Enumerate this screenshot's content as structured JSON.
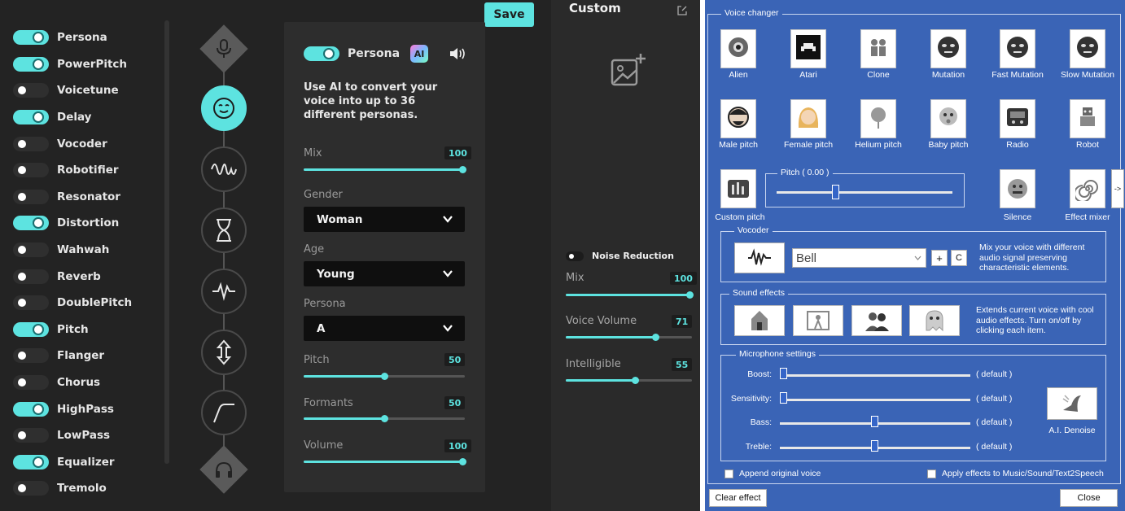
{
  "left_app": {
    "effects": [
      {
        "label": "Persona",
        "on": true
      },
      {
        "label": "PowerPitch",
        "on": true
      },
      {
        "label": "Voicetune",
        "on": false
      },
      {
        "label": "Delay",
        "on": true
      },
      {
        "label": "Vocoder",
        "on": false
      },
      {
        "label": "Robotifier",
        "on": false
      },
      {
        "label": "Resonator",
        "on": false
      },
      {
        "label": "Distortion",
        "on": true
      },
      {
        "label": "Wahwah",
        "on": false
      },
      {
        "label": "Reverb",
        "on": false
      },
      {
        "label": "DoublePitch",
        "on": false
      },
      {
        "label": "Pitch",
        "on": true
      },
      {
        "label": "Flanger",
        "on": false
      },
      {
        "label": "Chorus",
        "on": false
      },
      {
        "label": "HighPass",
        "on": true
      },
      {
        "label": "LowPass",
        "on": false
      },
      {
        "label": "Equalizer",
        "on": true
      },
      {
        "label": "Tremolo",
        "on": false
      }
    ],
    "chain_icons": [
      "mic-icon",
      "face-icon",
      "wave-icon",
      "hourglass-icon",
      "pulse-icon",
      "updown-arrow-icon",
      "curve-icon",
      "headphones-icon"
    ],
    "save_label": "Save",
    "panel": {
      "title": "Persona",
      "ai_label": "AI",
      "description": "Use AI to convert your voice into up to 36 different personas.",
      "mix": {
        "label": "Mix",
        "value": "100"
      },
      "gender": {
        "label": "Gender",
        "value": "Woman"
      },
      "age": {
        "label": "Age",
        "value": "Young"
      },
      "persona": {
        "label": "Persona",
        "value": "A"
      },
      "pitch": {
        "label": "Pitch",
        "value": "50"
      },
      "formants": {
        "label": "Formants",
        "value": "50"
      },
      "volume": {
        "label": "Volume",
        "value": "100"
      }
    },
    "custom": {
      "title": "Custom",
      "noise_reduction": "Noise Reduction",
      "mix": {
        "label": "Mix",
        "value": "100"
      },
      "voice_volume": {
        "label": "Voice Volume",
        "value": "71"
      },
      "intelligible": {
        "label": "Intelligible",
        "value": "55"
      }
    },
    "accent": "#5de3e0"
  },
  "right_app": {
    "voice_changer_title": "Voice changer",
    "voices": [
      {
        "label": "Alien",
        "icon": "alien-icon"
      },
      {
        "label": "Atari",
        "icon": "atari-icon"
      },
      {
        "label": "Clone",
        "icon": "clone-icon"
      },
      {
        "label": "Mutation",
        "icon": "mutation-icon"
      },
      {
        "label": "Fast Mutation",
        "icon": "fast-mutation-icon"
      },
      {
        "label": "Slow Mutation",
        "icon": "slow-mutation-icon"
      },
      {
        "label": "Male pitch",
        "icon": "male-icon"
      },
      {
        "label": "Female pitch",
        "icon": "female-icon"
      },
      {
        "label": "Helium pitch",
        "icon": "balloon-icon"
      },
      {
        "label": "Baby pitch",
        "icon": "baby-icon"
      },
      {
        "label": "Radio",
        "icon": "radio-icon"
      },
      {
        "label": "Robot",
        "icon": "robot-icon"
      }
    ],
    "custom_pitch": "Custom pitch",
    "pitch_label": "Pitch ( 0.00 )",
    "silence": "Silence",
    "effect_mixer": "Effect mixer",
    "arrow": "->",
    "vocoder": {
      "title": "Vocoder",
      "selected": "Bell",
      "plus": "+",
      "c": "C",
      "description": "Mix your voice with different audio signal preserving characteristic elements."
    },
    "sound_effects": {
      "title": "Sound effects",
      "description": "Extends current voice with cool audio effects. Turn on/off by clicking each item."
    },
    "microphone": {
      "title": "Microphone settings",
      "rows": [
        {
          "label": "Boost:",
          "value": "( default )"
        },
        {
          "label": "Sensitivity:",
          "value": "( default )"
        },
        {
          "label": "Bass:",
          "value": "( default )"
        },
        {
          "label": "Treble:",
          "value": "( default )"
        }
      ],
      "denoise": "A.I. Denoise"
    },
    "append_original": "Append original voice",
    "apply_effects": "Apply effects to Music/Sound/Text2Speech",
    "clear_effect": "Clear effect",
    "close": "Close"
  }
}
